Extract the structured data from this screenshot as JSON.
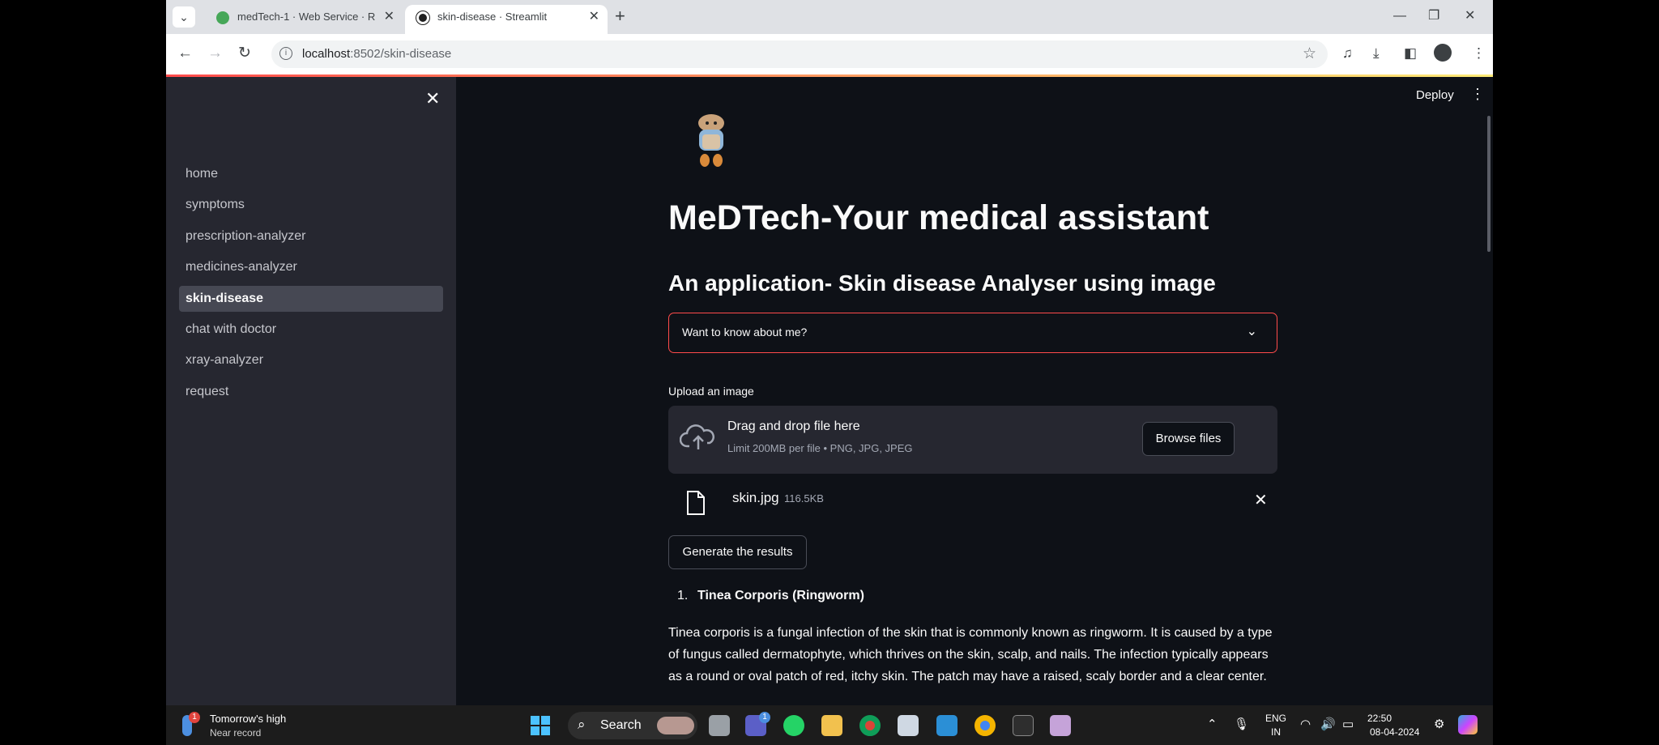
{
  "browser": {
    "tabs": [
      {
        "title": "medTech-1 · Web Service · Re",
        "active": false
      },
      {
        "title": "skin-disease · Streamlit",
        "active": true
      }
    ],
    "url_host": "localhost",
    "url_path": ":8502/skin-disease"
  },
  "sidebar": {
    "items": [
      {
        "label": "home"
      },
      {
        "label": "symptoms"
      },
      {
        "label": "prescription-analyzer"
      },
      {
        "label": "medicines-analyzer"
      },
      {
        "label": "skin-disease",
        "active": true
      },
      {
        "label": "chat with doctor"
      },
      {
        "label": "xray-analyzer"
      },
      {
        "label": "request"
      }
    ]
  },
  "header": {
    "deploy_label": "Deploy"
  },
  "main": {
    "title": "MeDTech-Your medical assistant",
    "subtitle": "An application- Skin disease Analyser using image",
    "expander_label": "Want to know about me?",
    "upload_label": "Upload an image",
    "dropzone": {
      "title": "Drag and drop file here",
      "limit": "Limit 200MB per file • PNG, JPG, JPEG",
      "browse_label": "Browse files"
    },
    "uploaded_file": {
      "name": "skin.jpg",
      "size": "116.5KB"
    },
    "generate_label": "Generate the results",
    "result": {
      "number": "1.",
      "title": "Tinea Corporis (Ringworm)",
      "text": "Tinea corporis is a fungal infection of the skin that is commonly known as ringworm. It is caused by a type of fungus called dermatophyte, which thrives on the skin, scalp, and nails. The infection typically appears as a round or oval patch of red, itchy skin. The patch may have a raised, scaly border and a clear center."
    }
  },
  "taskbar": {
    "weather_badge": "1",
    "weather_line1": "Tomorrow's high",
    "weather_line2": "Near record",
    "search_label": "Search",
    "teams_badge": "1",
    "lang_line1": "ENG",
    "lang_line2": "IN",
    "time": "22:50",
    "date": "08-04-2024"
  },
  "colors": {
    "accent": "#ff4b4b",
    "sidebar_bg": "#262730",
    "main_bg": "#0e1117"
  }
}
